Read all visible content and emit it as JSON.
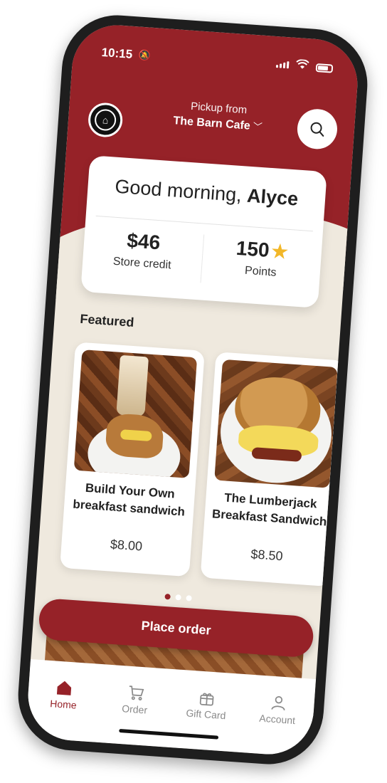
{
  "status": {
    "time": "10:15"
  },
  "header": {
    "pickup_label": "Pickup from",
    "location": "The Barn Cafe"
  },
  "greeting": {
    "prefix": "Good morning, ",
    "name": "Alyce"
  },
  "stats": {
    "credit_value": "$46",
    "credit_label": "Store credit",
    "points_value": "150",
    "points_label": "Points"
  },
  "featured": {
    "title": "Featured",
    "items": [
      {
        "name": "Build Your Own breakfast sandwich",
        "price": "$8.00"
      },
      {
        "name": "The Lumberjack Breakfast Sandwich",
        "price": "$8.50"
      }
    ]
  },
  "carousel": {
    "current": 1,
    "total": 3
  },
  "cta": {
    "label": "Place order"
  },
  "tabs": [
    {
      "label": "Home",
      "icon": "home-icon",
      "active": true
    },
    {
      "label": "Order",
      "icon": "cart-icon",
      "active": false
    },
    {
      "label": "Gift Card",
      "icon": "gift-card-icon",
      "active": false
    },
    {
      "label": "Account",
      "icon": "account-icon",
      "active": false
    }
  ],
  "colors": {
    "brand": "#962228",
    "background": "#efe9de",
    "star": "#f2b728"
  }
}
